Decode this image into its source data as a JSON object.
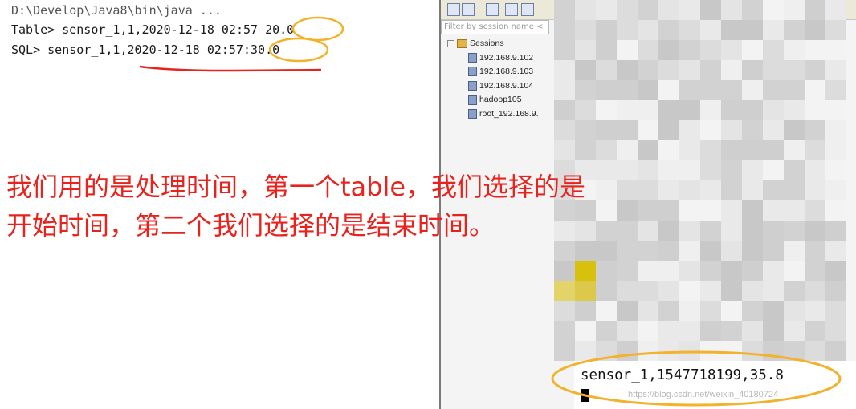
{
  "console": {
    "title": "D:\\Develop\\Java8\\bin\\java ...",
    "lines": [
      {
        "prefix": "Table> sensor_1,1,2020-12-18 02:57",
        "value": "20.0"
      },
      {
        "prefix": "SQL> sensor_1,1,2020-12-18 02:57",
        "value": ":30.0"
      }
    ]
  },
  "session_panel": {
    "filter_placeholder": "Filter by session name <",
    "root_label": "Sessions",
    "items": [
      "192.168.9.102",
      "192.168.9.103",
      "192.168.9.104",
      "hadoop105",
      "root_192.168.9."
    ]
  },
  "annotation": {
    "line1": "我们用的是处理时间，第一个table，我们选择的是",
    "line2": "开始时间，第二个我们选择的是结束时间。"
  },
  "bottom_console": {
    "text": "sensor_1,1547718199,35.8"
  },
  "watermark": "https://blog.csdn.net/weixin_40180724",
  "colors": {
    "annotation_red": "#e8231e",
    "highlight_orange": "#f2b22b"
  }
}
